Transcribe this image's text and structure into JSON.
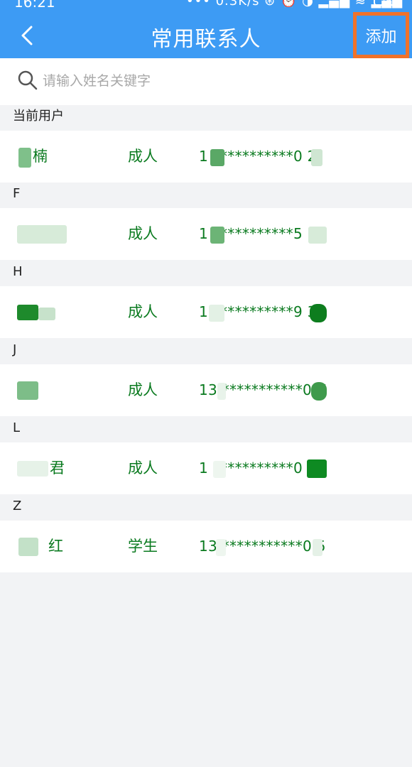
{
  "status": {
    "time": "16:21",
    "network": "••• 0.3K/s ⊛ ⏰ ◑ ▂▄▆ ≋ ▂▄▆",
    "battery": "74"
  },
  "header": {
    "title": "常用联系人",
    "add_label": "添加"
  },
  "search": {
    "placeholder": "请输入姓名关键字",
    "value": ""
  },
  "sections": [
    {
      "label": "当前用户",
      "rows": [
        {
          "name": "楠",
          "type": "成人",
          "id": "1 ***********0 2"
        }
      ]
    },
    {
      "label": "F",
      "rows": [
        {
          "name": "",
          "type": "成人",
          "id": "1 ***********5 2"
        }
      ]
    },
    {
      "label": "H",
      "rows": [
        {
          "name": "",
          "type": "成人",
          "id": "1 ***********9 3"
        }
      ]
    },
    {
      "label": "J",
      "rows": [
        {
          "name": "",
          "type": "成人",
          "id": "13 ***********0 X"
        }
      ]
    },
    {
      "label": "L",
      "rows": [
        {
          "name": "君",
          "type": "成人",
          "id": "1 ***********0"
        }
      ]
    },
    {
      "label": "Z",
      "rows": [
        {
          "name": "红",
          "type": "学生",
          "id": "13 ***********0 5"
        }
      ]
    }
  ]
}
